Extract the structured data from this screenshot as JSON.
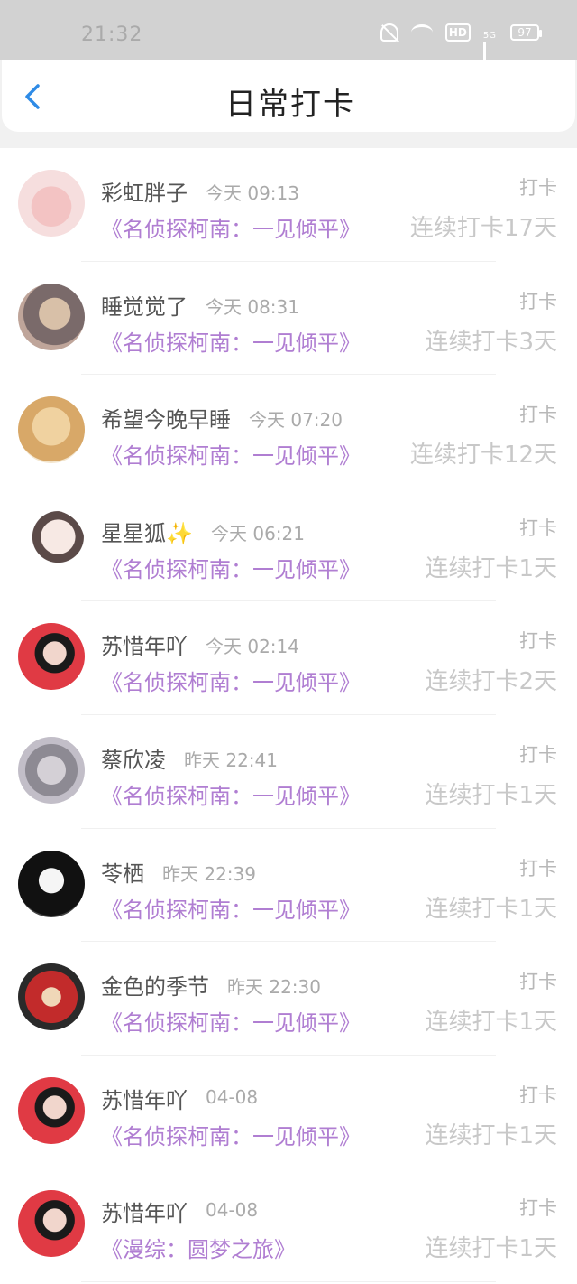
{
  "status_bar": {
    "time": "21:32",
    "hd": "HD",
    "net": "5G",
    "battery": "97"
  },
  "header": {
    "title": "日常打卡"
  },
  "items": [
    {
      "name": "彩虹胖子",
      "time": "今天 09:13",
      "book": "《名侦探柯南：一见倾平》",
      "action": "打卡",
      "streak": "连续打卡17天",
      "avatar": "pig-avatar"
    },
    {
      "name": "睡觉觉了",
      "time": "今天 08:31",
      "book": "《名侦探柯南：一见倾平》",
      "action": "打卡",
      "streak": "连续打卡3天",
      "avatar": "anime-boy-avatar"
    },
    {
      "name": "希望今晚早睡",
      "time": "今天 07:20",
      "book": "《名侦探柯南：一见倾平》",
      "action": "打卡",
      "streak": "连续打卡12天",
      "avatar": "dog-avatar"
    },
    {
      "name": "星星狐✨",
      "time": "今天 06:21",
      "book": "《名侦探柯南：一见倾平》",
      "action": "打卡",
      "streak": "连续打卡1天",
      "avatar": "anime-girl-avatar"
    },
    {
      "name": "苏惜年吖",
      "time": "今天 02:14",
      "book": "《名侦探柯南：一见倾平》",
      "action": "打卡",
      "streak": "连续打卡2天",
      "avatar": "costume-girl-avatar"
    },
    {
      "name": "蔡欣凌",
      "time": "昨天 22:41",
      "book": "《名侦探柯南：一见倾平》",
      "action": "打卡",
      "streak": "连续打卡1天",
      "avatar": "gray-girl-avatar"
    },
    {
      "name": "苓栖",
      "time": "昨天 22:39",
      "book": "《名侦探柯南：一见倾平》",
      "action": "打卡",
      "streak": "连续打卡1天",
      "avatar": "manga-boy-avatar"
    },
    {
      "name": "金色的季节",
      "time": "昨天 22:30",
      "book": "《名侦探柯南：一见倾平》",
      "action": "打卡",
      "streak": "连续打卡1天",
      "avatar": "athlete-avatar"
    },
    {
      "name": "苏惜年吖",
      "time": "04-08",
      "book": "《名侦探柯南：一见倾平》",
      "action": "打卡",
      "streak": "连续打卡1天",
      "avatar": "costume-girl-avatar"
    },
    {
      "name": "苏惜年吖",
      "time": "04-08",
      "book": "《漫综：圆梦之旅》",
      "action": "打卡",
      "streak": "连续打卡1天",
      "avatar": "costume-girl-avatar"
    }
  ]
}
